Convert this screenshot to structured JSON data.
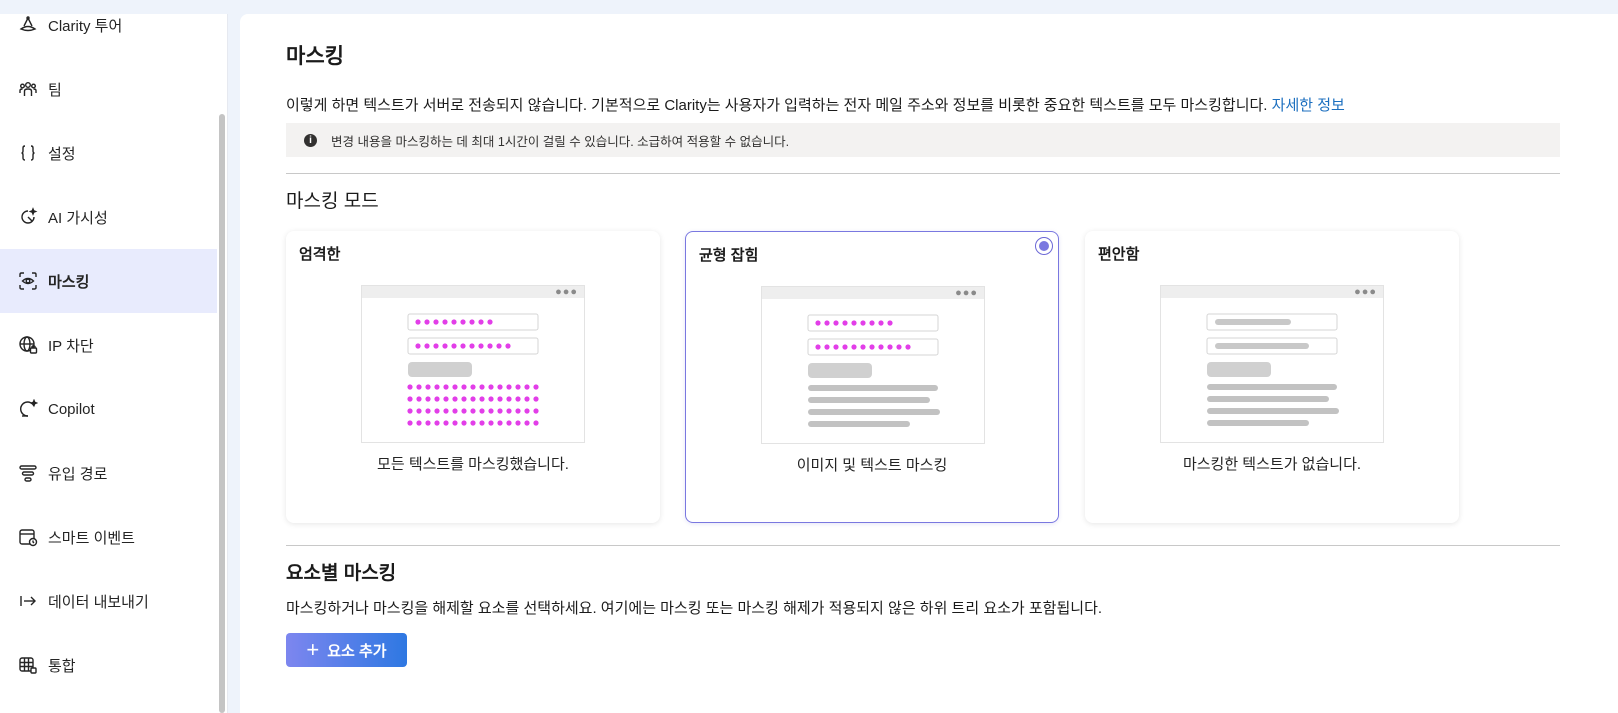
{
  "sidebar": {
    "items": [
      {
        "label": "Clarity 투어",
        "icon": "hat-icon",
        "active": false
      },
      {
        "label": "팀",
        "icon": "team-icon",
        "active": false
      },
      {
        "label": "설정",
        "icon": "braces-icon",
        "active": false
      },
      {
        "label": "AI 가시성",
        "icon": "ai-visibility-icon",
        "active": false
      },
      {
        "label": "마스킹",
        "icon": "masking-icon",
        "active": true
      },
      {
        "label": "IP 차단",
        "icon": "globe-lock-icon",
        "active": false
      },
      {
        "label": "Copilot",
        "icon": "copilot-icon",
        "active": false
      },
      {
        "label": "유입 경로",
        "icon": "funnel-icon",
        "active": false
      },
      {
        "label": "스마트 이벤트",
        "icon": "smart-event-icon",
        "active": false
      },
      {
        "label": "데이터 내보내기",
        "icon": "export-arrow-icon",
        "active": false
      },
      {
        "label": "통합",
        "icon": "integration-icon",
        "active": false
      }
    ]
  },
  "main": {
    "title": "마스킹",
    "description": "이렇게 하면 텍스트가 서버로 전송되지 않습니다. 기본적으로 Clarity는 사용자가 입력하는 전자 메일 주소와 정보를 비롯한 중요한 텍스트를 모두 마스킹합니다.",
    "learn_more": "자세한 정보",
    "info_message": "변경 내용을 마스킹하는 데 최대 1시간이 걸릴 수 있습니다. 소급하여 적용할 수 없습니다.",
    "masking_mode": {
      "title": "마스킹 모드",
      "selected": "균형 잡힘",
      "cards": [
        {
          "title": "엄격한",
          "caption": "모든 텍스트를 마스킹했습니다."
        },
        {
          "title": "균형 잡힘",
          "caption": "이미지 및 텍스트 마스킹"
        },
        {
          "title": "편안함",
          "caption": "마스킹한 텍스트가 없습니다."
        }
      ]
    },
    "element_masking": {
      "title": "요소별 마스킹",
      "description": "마스킹하거나 마스킹을 해제할 요소를 선택하세요. 여기에는 마스킹 또는 마스킹 해제가 적용되지 않은 하위 트리 요소가 포함됩니다.",
      "add_button": "요소 추가"
    }
  },
  "colors": {
    "accent": "#7a78e0",
    "link": "#1c6fbf",
    "mask_dot": "#e23ee8",
    "active_nav": "#e8ebfd",
    "button_gradient": [
      "#7d86ef",
      "#2e78e2"
    ]
  }
}
